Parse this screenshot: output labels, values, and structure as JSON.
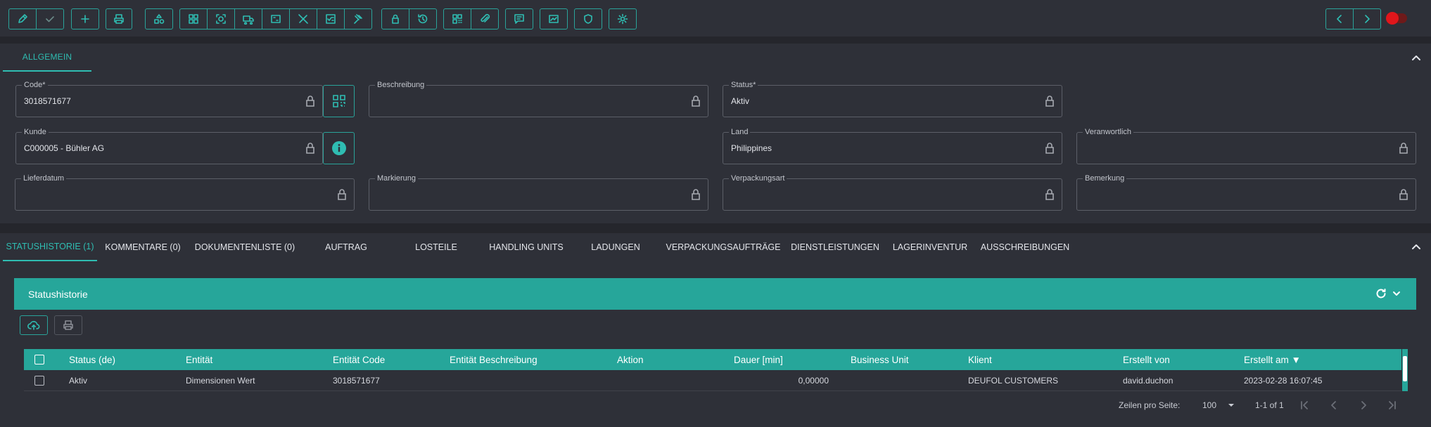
{
  "toolbar": {
    "icons": [
      "pencil-icon",
      "check-icon",
      "plus-icon",
      "printer-icon",
      "shapes-icon",
      "grid-icon",
      "scan-icon",
      "truck-icon",
      "frame-icon",
      "tools-icon",
      "checklist-icon",
      "gavel-icon",
      "lock-icon",
      "history-icon",
      "qr-icon",
      "attachment-icon",
      "comment-icon",
      "sign-icon",
      "shield-icon",
      "gear-icon",
      "chevron-left-icon",
      "chevron-right-icon"
    ]
  },
  "general": {
    "tab_label": "ALLGEMEIN",
    "fields": {
      "code": {
        "label": "Code*",
        "value": "3018571677"
      },
      "beschreibung": {
        "label": "Beschreibung",
        "value": ""
      },
      "status": {
        "label": "Status*",
        "value": "Aktiv"
      },
      "kunde": {
        "label": "Kunde",
        "value": "C000005 - Bühler AG"
      },
      "land": {
        "label": "Land",
        "value": "Philippines"
      },
      "veranwortlich": {
        "label": "Veranwortlich",
        "value": ""
      },
      "lieferdatum": {
        "label": "Lieferdatum",
        "value": ""
      },
      "markierung": {
        "label": "Markierung",
        "value": ""
      },
      "verpackungsart": {
        "label": "Verpackungsart",
        "value": ""
      },
      "bemerkung": {
        "label": "Bemerkung",
        "value": ""
      }
    }
  },
  "tabs": [
    {
      "label": "STATUSHISTORIE (1)",
      "active": true
    },
    {
      "label": "KOMMENTARE (0)"
    },
    {
      "label": "DOKUMENTENLISTE (0)"
    },
    {
      "label": "AUFTRAG"
    },
    {
      "label": "LOSTEILE"
    },
    {
      "label": "HANDLING UNITS"
    },
    {
      "label": "LADUNGEN"
    },
    {
      "label": "VERPACKUNGSAUFTRÄGE"
    },
    {
      "label": "DIENSTLEISTUNGEN"
    },
    {
      "label": "LAGERINVENTUR"
    },
    {
      "label": "AUSSCHREIBUNGEN"
    }
  ],
  "section": {
    "title": "Statushistorie"
  },
  "table": {
    "columns": [
      "Status (de)",
      "Entität",
      "Entität Code",
      "Entität Beschreibung",
      "Aktion",
      "Dauer [min]",
      "Business Unit",
      "Klient",
      "Erstellt von",
      "Erstellt am ▼"
    ],
    "rows": [
      [
        "Aktiv",
        "Dimensionen Wert",
        "3018571677",
        "",
        "",
        "0,00000",
        "",
        "DEUFOL CUSTOMERS",
        "david.duchon",
        "2023-02-28 16:07:45"
      ]
    ]
  },
  "pager": {
    "rows_label": "Zeilen pro Seite:",
    "rows_value": "100",
    "range": "1-1 of 1"
  },
  "colors": {
    "accent": "#26a69a",
    "toggle": "#e0161b"
  }
}
